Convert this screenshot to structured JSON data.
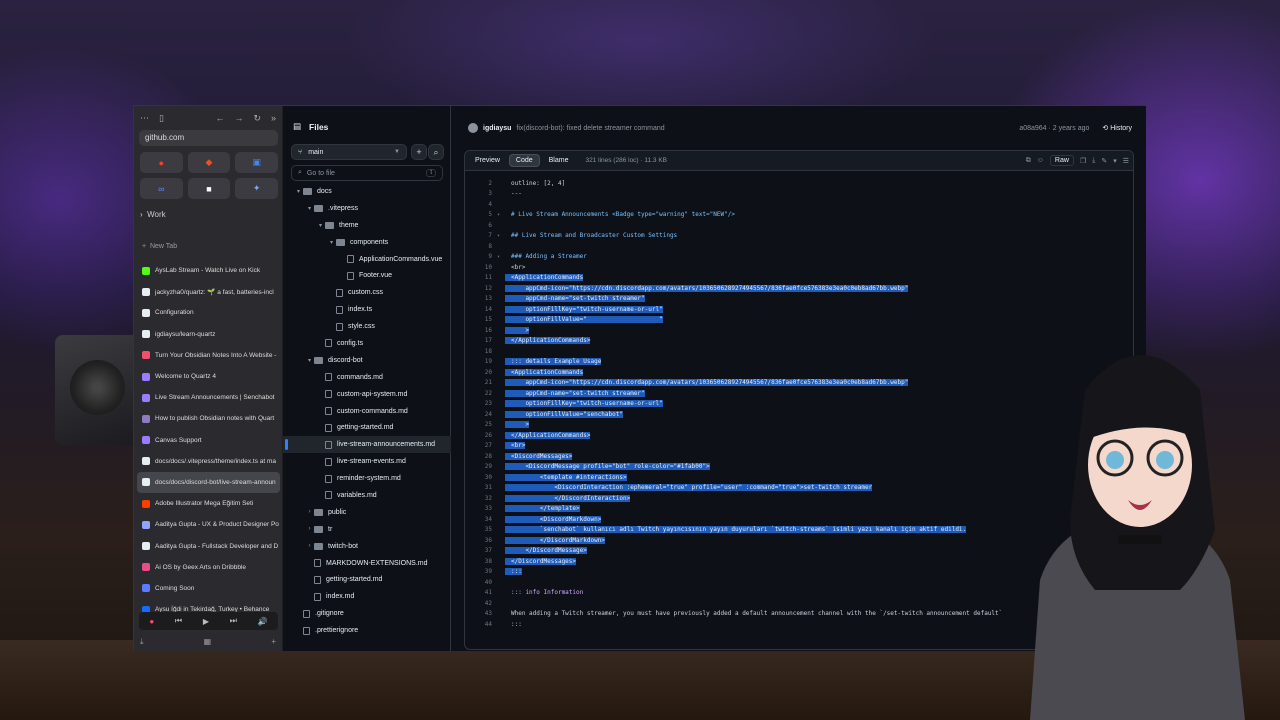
{
  "sidebar": {
    "url": "github.com",
    "section_label": "Work",
    "new_tab_label": "New Tab",
    "tabs": [
      {
        "label": "AysLab Stream - Watch Live on Kick",
        "color": "#53fc18"
      },
      {
        "label": "jackyzha0/quartz: 🌱 a fast, batteries-incl",
        "color": "#e6edf3"
      },
      {
        "label": "Configuration",
        "color": "#e6edf3"
      },
      {
        "label": "igdiaysu/learn-quartz",
        "color": "#e6edf3"
      },
      {
        "label": "Turn Your Obsidian Notes Into A Website -",
        "color": "#f0506e"
      },
      {
        "label": "Welcome to Quartz 4",
        "color": "#9b7bff"
      },
      {
        "label": "Live Stream Announcements | Senchabot",
        "color": "#9b7bff"
      },
      {
        "label": "How to publish Obsidian notes with Quart",
        "color": "#8e7cc3"
      },
      {
        "label": "Canvas Support",
        "color": "#9b7bff"
      },
      {
        "label": "docs/docs/.vitepress/theme/index.ts at ma",
        "color": "#e6edf3"
      },
      {
        "label": "docs/docs/discord-bot/live-stream-announ",
        "color": "#e6edf3"
      },
      {
        "label": "Adobe Illustrator Mega Eğitim Seti",
        "color": "#ff3d00"
      },
      {
        "label": "Aaditya Gupta - UX & Product Designer Po",
        "color": "#8fa3ff"
      },
      {
        "label": "Aaditya Gupta - Fullstack Developer and D",
        "color": "#e6edf3"
      },
      {
        "label": "Ai OS by Geex Arts on Dribbble",
        "color": "#ea4c89"
      },
      {
        "label": "Coming Soon",
        "color": "#5b7cff"
      },
      {
        "label": "Aysu İğdi in Tekirdağ, Turkey • Behance",
        "color": "#1769ff"
      }
    ],
    "active_tab_index": 10
  },
  "files": {
    "title": "Files",
    "branch": "main",
    "search_placeholder": "Go to file",
    "search_kbd": "t",
    "tree": [
      {
        "label": "docs",
        "type": "folder",
        "depth": 1,
        "open": true
      },
      {
        "label": ".vitepress",
        "type": "folder",
        "depth": 2,
        "open": true
      },
      {
        "label": "theme",
        "type": "folder",
        "depth": 3,
        "open": true
      },
      {
        "label": "components",
        "type": "folder",
        "depth": 4,
        "open": true
      },
      {
        "label": "ApplicationCommands.vue",
        "type": "file",
        "depth": 5
      },
      {
        "label": "Footer.vue",
        "type": "file",
        "depth": 5
      },
      {
        "label": "custom.css",
        "type": "file",
        "depth": 4
      },
      {
        "label": "index.ts",
        "type": "file",
        "depth": 4
      },
      {
        "label": "style.css",
        "type": "file",
        "depth": 4
      },
      {
        "label": "config.ts",
        "type": "file",
        "depth": 3
      },
      {
        "label": "discord-bot",
        "type": "folder",
        "depth": 2,
        "open": true
      },
      {
        "label": "commands.md",
        "type": "file",
        "depth": 3
      },
      {
        "label": "custom-api-system.md",
        "type": "file",
        "depth": 3
      },
      {
        "label": "custom-commands.md",
        "type": "file",
        "depth": 3
      },
      {
        "label": "getting-started.md",
        "type": "file",
        "depth": 3
      },
      {
        "label": "live-stream-announcements.md",
        "type": "file",
        "depth": 3,
        "selected": true
      },
      {
        "label": "live-stream-events.md",
        "type": "file",
        "depth": 3
      },
      {
        "label": "reminder-system.md",
        "type": "file",
        "depth": 3
      },
      {
        "label": "variables.md",
        "type": "file",
        "depth": 3
      },
      {
        "label": "public",
        "type": "folder",
        "depth": 2,
        "open": false
      },
      {
        "label": "tr",
        "type": "folder",
        "depth": 2,
        "open": false
      },
      {
        "label": "twitch-bot",
        "type": "folder",
        "depth": 2,
        "open": false
      },
      {
        "label": "MARKDOWN-EXTENSIONS.md",
        "type": "file",
        "depth": 2
      },
      {
        "label": "getting-started.md",
        "type": "file",
        "depth": 2
      },
      {
        "label": "index.md",
        "type": "file",
        "depth": 2
      },
      {
        "label": ".gitignore",
        "type": "file",
        "depth": 1
      },
      {
        "label": ".prettierignore",
        "type": "file",
        "depth": 1
      }
    ]
  },
  "commit": {
    "user": "igdiaysu",
    "message": "fix(discord-bot): fixed delete streamer command",
    "meta": "a08a964 · 2 years ago",
    "history_label": "History"
  },
  "codebar": {
    "tabs": [
      "Preview",
      "Code",
      "Blame"
    ],
    "active": "Code",
    "info": "321 lines (286 loc) · 11.3 KB",
    "raw_label": "Raw"
  },
  "code": [
    {
      "n": "2",
      "t": "outline: [2, 4]"
    },
    {
      "n": "3",
      "t": "---"
    },
    {
      "n": "4",
      "t": ""
    },
    {
      "n": "5",
      "t": "# Live Stream Announcements <Badge type=\"warning\" text=\"NEW\"/>",
      "fold": true,
      "cls": "hd"
    },
    {
      "n": "6",
      "t": ""
    },
    {
      "n": "7",
      "t": "## Live Stream and Broadcaster Custom Settings",
      "fold": true,
      "cls": "hd"
    },
    {
      "n": "8",
      "t": ""
    },
    {
      "n": "9",
      "t": "### Adding a Streamer",
      "fold": true,
      "cls": "hd"
    },
    {
      "n": "10",
      "t": "<br>"
    },
    {
      "n": "11",
      "t": "<ApplicationCommands",
      "hl": true
    },
    {
      "n": "12",
      "t": "    appCmd-icon=\"https://cdn.discordapp.com/avatars/1036506289274945567/836fae0fce576383e3ea0c0eb8ad67bb.webp\"",
      "hl": true
    },
    {
      "n": "13",
      "t": "    appCmd-name=\"set-twitch streamer\"",
      "hl": true
    },
    {
      "n": "14",
      "t": "    optionFillKey=\"twitch-username-or-url\"",
      "hl": true
    },
    {
      "n": "15",
      "t": "    optionFillValue=\"                    \"",
      "hl": true
    },
    {
      "n": "16",
      "t": "    >",
      "hl": true
    },
    {
      "n": "17",
      "t": "</ApplicationCommands>",
      "hl": true
    },
    {
      "n": "18",
      "t": ""
    },
    {
      "n": "19",
      "t": "::: details Example Usage",
      "hl": true
    },
    {
      "n": "20",
      "t": "<ApplicationCommands",
      "hl": true
    },
    {
      "n": "21",
      "t": "    appCmd-icon=\"https://cdn.discordapp.com/avatars/1036506289274945567/836fae0fce576383e3ea0c0eb8ad67bb.webp\"",
      "hl": true
    },
    {
      "n": "22",
      "t": "    appCmd-name=\"set-twitch streamer\"",
      "hl": true
    },
    {
      "n": "23",
      "t": "    optionFillKey=\"twitch-username-or-url\"",
      "hl": true
    },
    {
      "n": "24",
      "t": "    optionFillValue=\"senchabot\"",
      "hl": true
    },
    {
      "n": "25",
      "t": "    >",
      "hl": true
    },
    {
      "n": "26",
      "t": "</ApplicationCommands>",
      "hl": true
    },
    {
      "n": "27",
      "t": "<br>",
      "hl": true
    },
    {
      "n": "28",
      "t": "<DiscordMessages>",
      "hl": true
    },
    {
      "n": "29",
      "t": "    <DiscordMessage profile=\"bot\" role-color=\"#1fab00\">",
      "hl": true
    },
    {
      "n": "30",
      "t": "        <template #interactions>",
      "hl": true
    },
    {
      "n": "31",
      "t": "            <DiscordInteraction :ephemeral=\"true\" profile=\"user\" :command=\"true\">set-twitch streamer",
      "hl": true
    },
    {
      "n": "32",
      "t": "            </DiscordInteraction>",
      "hl": true
    },
    {
      "n": "33",
      "t": "        </template>",
      "hl": true
    },
    {
      "n": "34",
      "t": "        <DiscordMarkdown>",
      "hl": true
    },
    {
      "n": "35",
      "t": "        `senchabot` kullanıcı adlı Twitch yayıncısının yayın duyuruları `twitch-streams` isimli yazı kanalı için aktif edildi.",
      "hl": true
    },
    {
      "n": "36",
      "t": "        </DiscordMarkdown>",
      "hl": true
    },
    {
      "n": "37",
      "t": "    </DiscordMessage>",
      "hl": true
    },
    {
      "n": "38",
      "t": "</DiscordMessages>",
      "hl": true
    },
    {
      "n": "39",
      "t": ":::",
      "hl": true
    },
    {
      "n": "40",
      "t": ""
    },
    {
      "n": "41",
      "t": "::: info Information",
      "cls": "kw"
    },
    {
      "n": "42",
      "t": ""
    },
    {
      "n": "43",
      "t": "When adding a Twitch streamer, you must have previously added a default announcement channel with the `/set-twitch announcement default`"
    },
    {
      "n": "44",
      "t": ":::"
    }
  ]
}
